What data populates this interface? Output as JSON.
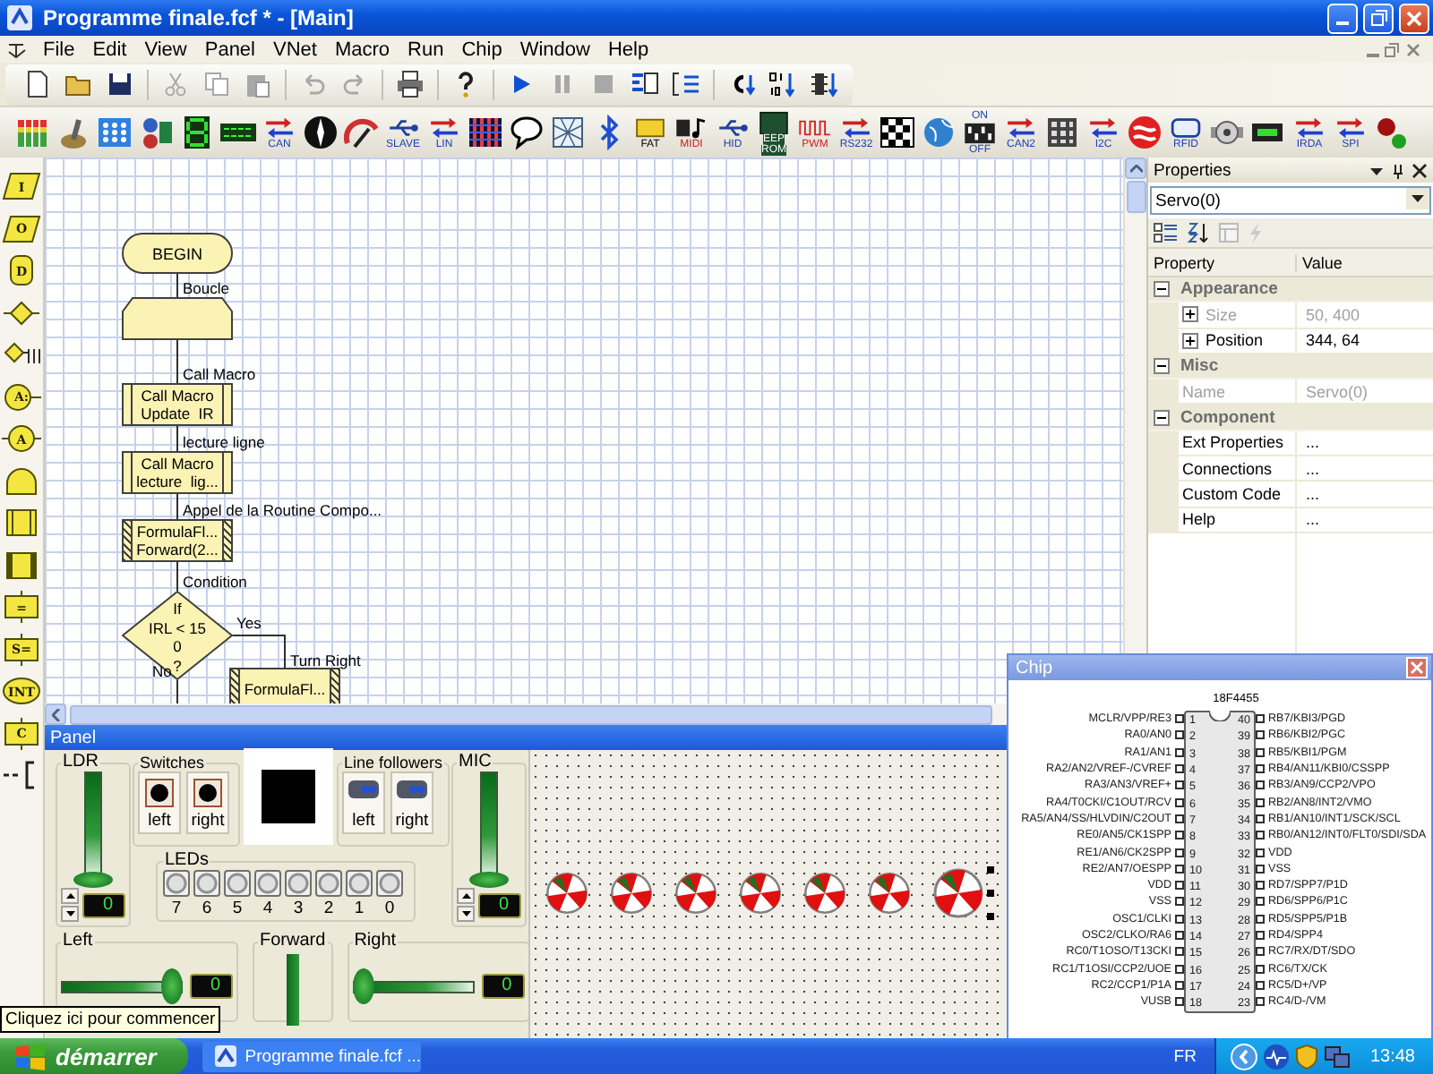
{
  "window": {
    "title": "Programme finale.fcf * - [Main]"
  },
  "menu": [
    "File",
    "Edit",
    "View",
    "Panel",
    "VNet",
    "Macro",
    "Run",
    "Chip",
    "Window",
    "Help"
  ],
  "toolbar": [
    [
      {
        "kind": "new",
        "disabled": false
      },
      {
        "kind": "open",
        "disabled": false
      },
      {
        "kind": "save",
        "disabled": false
      }
    ],
    [
      {
        "kind": "cut",
        "disabled": true
      },
      {
        "kind": "copy",
        "disabled": true
      },
      {
        "kind": "paste",
        "disabled": true
      }
    ],
    [
      {
        "kind": "undo",
        "disabled": true
      },
      {
        "kind": "redo",
        "disabled": true
      }
    ],
    [
      {
        "kind": "print",
        "disabled": false
      }
    ],
    [
      {
        "kind": "help",
        "disabled": false
      }
    ],
    [
      {
        "kind": "run",
        "disabled": false
      },
      {
        "kind": "pause",
        "disabled": true
      },
      {
        "kind": "stop",
        "disabled": true
      },
      {
        "kind": "step-into",
        "disabled": false
      },
      {
        "kind": "step-over",
        "disabled": false
      }
    ],
    [
      {
        "kind": "compile-c",
        "disabled": false
      },
      {
        "kind": "compile-hex",
        "disabled": false
      },
      {
        "kind": "compile-chip",
        "disabled": false
      }
    ]
  ],
  "components": [
    {
      "kind": "bars"
    },
    {
      "kind": "toggle"
    },
    {
      "kind": "dots"
    },
    {
      "kind": "sensor"
    },
    {
      "kind": "seg"
    },
    {
      "kind": "lcd"
    },
    {
      "kind": "bus",
      "labels": [
        "CAN"
      ]
    },
    {
      "kind": "compass"
    },
    {
      "kind": "gauge"
    },
    {
      "kind": "usb",
      "labels": [
        "SLAVE"
      ]
    },
    {
      "kind": "bus",
      "labels": [
        "LIN"
      ]
    },
    {
      "kind": "matrix"
    },
    {
      "kind": "bubble"
    },
    {
      "kind": "web"
    },
    {
      "kind": "bluetooth"
    },
    {
      "kind": "card",
      "labels": [
        "FAT"
      ]
    },
    {
      "kind": "note",
      "labels": [
        "MIDI"
      ]
    },
    {
      "kind": "usb",
      "labels": [
        "HID"
      ]
    },
    {
      "kind": "chip",
      "labels": [
        "EEP",
        "ROM"
      ]
    },
    {
      "kind": "wave",
      "labels": [
        "PWM"
      ]
    },
    {
      "kind": "bus",
      "labels": [
        "RS232"
      ]
    },
    {
      "kind": "flag"
    },
    {
      "kind": "globe"
    },
    {
      "kind": "dip",
      "labels": [
        "ON",
        "OFF"
      ]
    },
    {
      "kind": "bus",
      "labels": [
        "CAN2"
      ]
    },
    {
      "kind": "keypad"
    },
    {
      "kind": "bus",
      "labels": [
        "I2C"
      ]
    },
    {
      "kind": "zigbee"
    },
    {
      "kind": "tag",
      "labels": [
        "RFID"
      ]
    },
    {
      "kind": "motor"
    },
    {
      "kind": "battery"
    },
    {
      "kind": "bus",
      "labels": [
        "IRDA"
      ]
    },
    {
      "kind": "bus",
      "labels": [
        "SPI"
      ]
    },
    {
      "kind": "led"
    }
  ],
  "palette": [
    {
      "kind": "io",
      "label": "I"
    },
    {
      "kind": "io",
      "label": "O"
    },
    {
      "kind": "delay",
      "label": "D"
    },
    {
      "kind": "decision"
    },
    {
      "kind": "switch"
    },
    {
      "kind": "point",
      "label": "A:"
    },
    {
      "kind": "jump",
      "label": "A"
    },
    {
      "kind": "loop"
    },
    {
      "kind": "macro"
    },
    {
      "kind": "component"
    },
    {
      "kind": "calc",
      "label": "="
    },
    {
      "kind": "calc",
      "label": "S="
    },
    {
      "kind": "interrupt",
      "label": "INT"
    },
    {
      "kind": "calc",
      "label": "C"
    },
    {
      "kind": "comment"
    }
  ],
  "flowchart": {
    "nodes": [
      {
        "kind": "terminal",
        "lines": [
          "BEGIN"
        ]
      },
      {
        "kind": "loop",
        "caption": "Boucle"
      },
      {
        "kind": "macro",
        "caption": "Call Macro",
        "lines": [
          "Call Macro",
          "Update  IR"
        ]
      },
      {
        "kind": "macro",
        "caption": "lecture ligne",
        "lines": [
          "Call Macro",
          "lecture  lig..."
        ]
      },
      {
        "kind": "component",
        "caption": "Appel de la Routine Compo...",
        "lines": [
          "FormulaFl...",
          "Forward(2..."
        ]
      },
      {
        "kind": "decision",
        "caption": "Condition",
        "lines": [
          "If",
          "IRL < 15",
          "0",
          "?"
        ],
        "yes": "Yes",
        "no": "No"
      },
      {
        "kind": "component",
        "caption": "Turn Right",
        "lines": [
          "FormulaFl..."
        ]
      }
    ]
  },
  "properties": {
    "title": "Properties",
    "object": "Servo(0)",
    "columns": [
      "Property",
      "Value"
    ],
    "groups": [
      {
        "name": "Appearance",
        "expanded": true,
        "rows": [
          {
            "name": "Size",
            "value": "50, 400",
            "kind": "expandable",
            "disabled": true
          },
          {
            "name": "Position",
            "value": "344, 64",
            "kind": "expandable",
            "disabled": false
          }
        ]
      },
      {
        "name": "Misc",
        "expanded": true,
        "rows": [
          {
            "name": "Name",
            "value": "Servo(0)",
            "kind": "plain",
            "disabled": true
          }
        ]
      },
      {
        "name": "Component",
        "expanded": true,
        "rows": [
          {
            "name": "Ext Properties",
            "value": "...",
            "kind": "plain",
            "disabled": false
          },
          {
            "name": "Connections",
            "value": "...",
            "kind": "plain",
            "disabled": false
          },
          {
            "name": "Custom Code",
            "value": "...",
            "kind": "plain",
            "disabled": false
          },
          {
            "name": "Help",
            "value": "...",
            "kind": "plain",
            "disabled": false
          }
        ]
      }
    ]
  },
  "panel": {
    "title": "Panel",
    "ldr": {
      "label": "LDR",
      "level": 0,
      "reading": "0"
    },
    "switches": {
      "label": "Switches",
      "buttons": [
        "left",
        "right"
      ]
    },
    "line_followers": {
      "label": "Line followers",
      "buttons": [
        "left",
        "right"
      ]
    },
    "mic": {
      "label": "MIC",
      "level": 0,
      "reading": "0"
    },
    "leds": {
      "label": "LEDs",
      "items": [
        {
          "label": "7",
          "on": false
        },
        {
          "label": "6",
          "on": false
        },
        {
          "label": "5",
          "on": false
        },
        {
          "label": "4",
          "on": false
        },
        {
          "label": "3",
          "on": false
        },
        {
          "label": "2",
          "on": false
        },
        {
          "label": "1",
          "on": false
        },
        {
          "label": "0",
          "on": false
        }
      ]
    },
    "left": {
      "label": "Left",
      "level": 1,
      "reading": "0"
    },
    "forward": {
      "label": "Forward"
    },
    "right": {
      "label": "Right",
      "level": 0,
      "reading": "0"
    },
    "servos": [
      {
        "selected": false
      },
      {
        "selected": false
      },
      {
        "selected": false
      },
      {
        "selected": false
      },
      {
        "selected": false
      },
      {
        "selected": false
      },
      {
        "selected": true
      }
    ]
  },
  "chip": {
    "title": "Chip",
    "part": "18F4455",
    "left_pins": [
      {
        "number": "1",
        "name": "MCLR/VPP/RE3"
      },
      {
        "number": "2",
        "name": "RA0/AN0"
      },
      {
        "number": "3",
        "name": "RA1/AN1"
      },
      {
        "number": "4",
        "name": "RA2/AN2/VREF-/CVREF"
      },
      {
        "number": "5",
        "name": "RA3/AN3/VREF+"
      },
      {
        "number": "6",
        "name": "RA4/T0CKI/C1OUT/RCV"
      },
      {
        "number": "7",
        "name": "RA5/AN4/SS/HLVDIN/C2OUT"
      },
      {
        "number": "8",
        "name": "RE0/AN5/CK1SPP"
      },
      {
        "number": "9",
        "name": "RE1/AN6/CK2SPP"
      },
      {
        "number": "10",
        "name": "RE2/AN7/OESPP"
      },
      {
        "number": "11",
        "name": "VDD"
      },
      {
        "number": "12",
        "name": "VSS"
      },
      {
        "number": "13",
        "name": "OSC1/CLKI"
      },
      {
        "number": "14",
        "name": "OSC2/CLKO/RA6"
      },
      {
        "number": "15",
        "name": "RC0/T1OSO/T13CKI"
      },
      {
        "number": "16",
        "name": "RC1/T1OSI/CCP2/UOE"
      },
      {
        "number": "17",
        "name": "RC2/CCP1/P1A"
      },
      {
        "number": "18",
        "name": "VUSB"
      }
    ],
    "right_pins": [
      {
        "number": "40",
        "name": "RB7/KBI3/PGD"
      },
      {
        "number": "39",
        "name": "RB6/KBI2/PGC"
      },
      {
        "number": "38",
        "name": "RB5/KBI1/PGM"
      },
      {
        "number": "37",
        "name": "RB4/AN11/KBI0/CSSPP"
      },
      {
        "number": "36",
        "name": "RB3/AN9/CCP2/VPO"
      },
      {
        "number": "35",
        "name": "RB2/AN8/INT2/VMO"
      },
      {
        "number": "34",
        "name": "RB1/AN10/INT1/SCK/SCL"
      },
      {
        "number": "33",
        "name": "RB0/AN12/INT0/FLT0/SDI/SDA"
      },
      {
        "number": "32",
        "name": "VDD"
      },
      {
        "number": "31",
        "name": "VSS"
      },
      {
        "number": "30",
        "name": "RD7/SPP7/P1D"
      },
      {
        "number": "29",
        "name": "RD6/SPP6/P1C"
      },
      {
        "number": "28",
        "name": "RD5/SPP5/P1B"
      },
      {
        "number": "27",
        "name": "RD4/SPP4"
      },
      {
        "number": "26",
        "name": "RC7/RX/DT/SDO"
      },
      {
        "number": "25",
        "name": "RC6/TX/CK"
      },
      {
        "number": "24",
        "name": "RC5/D+/VP"
      },
      {
        "number": "23",
        "name": "RC4/D-/VM"
      }
    ]
  },
  "tooltip": "Cliquez ici pour commencer",
  "taskbar": {
    "start": "démarrer",
    "tasks": [
      {
        "label": "Programme finale.fcf ...",
        "selected": false
      }
    ],
    "language": "FR",
    "clock": "13:48"
  }
}
